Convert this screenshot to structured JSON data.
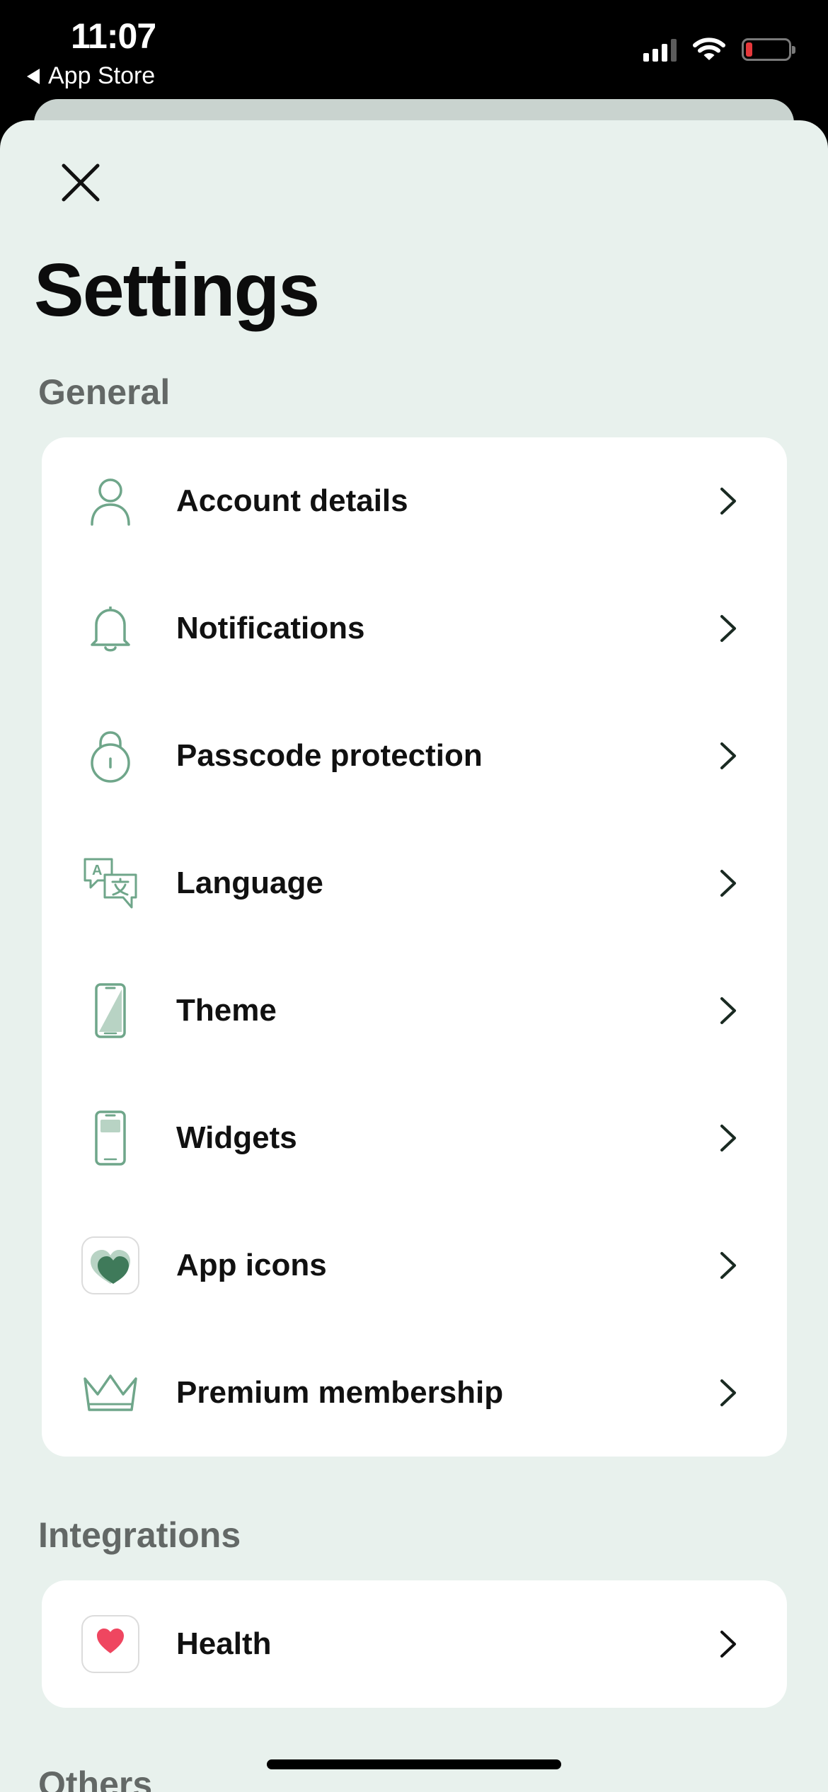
{
  "status_bar": {
    "time": "11:07",
    "back_label": "App Store"
  },
  "header": {
    "title": "Settings"
  },
  "sections": {
    "general": {
      "title": "General",
      "items": [
        {
          "label": "Account details",
          "icon": "person-icon"
        },
        {
          "label": "Notifications",
          "icon": "bell-icon"
        },
        {
          "label": "Passcode protection",
          "icon": "lock-icon"
        },
        {
          "label": "Language",
          "icon": "translate-icon"
        },
        {
          "label": "Theme",
          "icon": "phone-theme-icon"
        },
        {
          "label": "Widgets",
          "icon": "phone-widget-icon"
        },
        {
          "label": "App icons",
          "icon": "app-icon-tile"
        },
        {
          "label": "Premium membership",
          "icon": "crown-icon"
        }
      ]
    },
    "integrations": {
      "title": "Integrations",
      "items": [
        {
          "label": "Health",
          "icon": "health-heart-icon"
        }
      ]
    },
    "others": {
      "title": "Others"
    }
  },
  "colors": {
    "background": "#e8f1ed",
    "card": "#ffffff",
    "accent_green": "#6fa68a",
    "health_heart": "#ef4660",
    "battery_low": "#e5383b"
  }
}
